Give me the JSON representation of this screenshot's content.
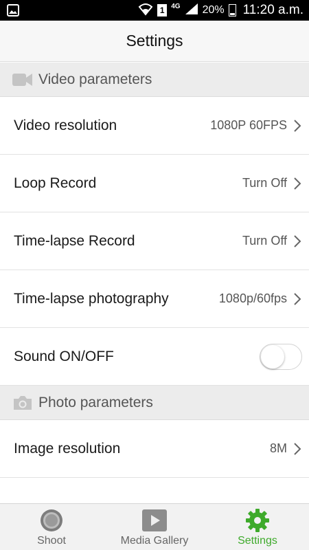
{
  "statusbar": {
    "network": "4G",
    "sim_badge": "1",
    "battery": "20%",
    "time": "11:20 a.m."
  },
  "header": {
    "title": "Settings"
  },
  "sections": {
    "video": {
      "title": "Video parameters",
      "icon": "video-camera-icon",
      "rows": [
        {
          "label": "Video resolution",
          "value": "1080P 60FPS"
        },
        {
          "label": "Loop Record",
          "value": "Turn Off"
        },
        {
          "label": "Time-lapse Record",
          "value": "Turn Off"
        },
        {
          "label": "Time-lapse photography",
          "value": "1080p/60fps"
        }
      ],
      "sound": {
        "label": "Sound ON/OFF",
        "state": "off"
      }
    },
    "photo": {
      "title": "Photo parameters",
      "icon": "camera-icon",
      "rows": [
        {
          "label": "Image resolution",
          "value": "8M"
        }
      ]
    }
  },
  "bottomnav": {
    "items": [
      {
        "label": "Shoot",
        "icon": "shutter-icon"
      },
      {
        "label": "Media Gallery",
        "icon": "play-icon"
      },
      {
        "label": "Settings",
        "icon": "gear-icon",
        "active": true
      }
    ]
  },
  "colors": {
    "accent": "#3eaa2b",
    "section_bg": "#ececec",
    "header_bg": "#f7f7f7"
  }
}
